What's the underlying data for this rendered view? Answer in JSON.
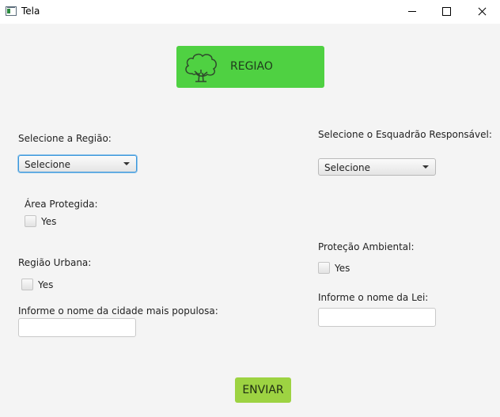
{
  "window": {
    "title": "Tela"
  },
  "header": {
    "title": "REGIAO",
    "icon": "tree-icon",
    "color": "#4fd142"
  },
  "form": {
    "region_label": "Selecione a Região:",
    "region_select": "Selecione",
    "protected_area_label": "Área Protegida:",
    "protected_area_option": "Yes",
    "urban_region_label": "Região Urbana:",
    "urban_region_option": "Yes",
    "city_label": "Informe o nome da cidade mais populosa:",
    "city_value": "",
    "squad_label": "Selecione o Esquadrão Responsável:",
    "squad_select": "Selecione",
    "environmental_label": "Proteção Ambiental:",
    "environmental_option": "Yes",
    "law_label": "Informe o nome da Lei:",
    "law_value": ""
  },
  "submit": {
    "label": "ENVIAR",
    "color": "#9dd342"
  }
}
